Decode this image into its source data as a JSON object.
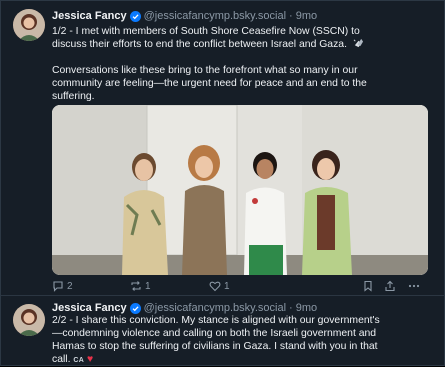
{
  "accent": "#0a7aff",
  "posts": [
    {
      "author": "Jessica Fancy",
      "handle": "@jessicafancymp.bsky.social",
      "separator": "·",
      "time": "9mo",
      "text_lines": [
        "1/2 - I met with members of South Shore Ceasefire Now (SSCN) to",
        "discuss their efforts to end the conflict between Israel and Gaza."
      ],
      "text_lines_2": [
        "Conversations like these bring to the forefront what so many in our",
        "community are feeling—the urgent need for peace and an end to the",
        "suffering."
      ],
      "counts": {
        "replies": "2",
        "reposts": "1",
        "likes": "1"
      }
    },
    {
      "author": "Jessica Fancy",
      "handle": "@jessicafancymp.bsky.social",
      "separator": "·",
      "time": "9mo",
      "text_lines": [
        "2/2 - I share this conviction. My stance is aligned with our government's",
        "—condemning violence and calling on both the Israeli government and",
        "Hamas to stop the suffering of civilians in Gaza. I stand with you in that",
        "call."
      ],
      "flag": "CA",
      "heart": "♥"
    }
  ]
}
